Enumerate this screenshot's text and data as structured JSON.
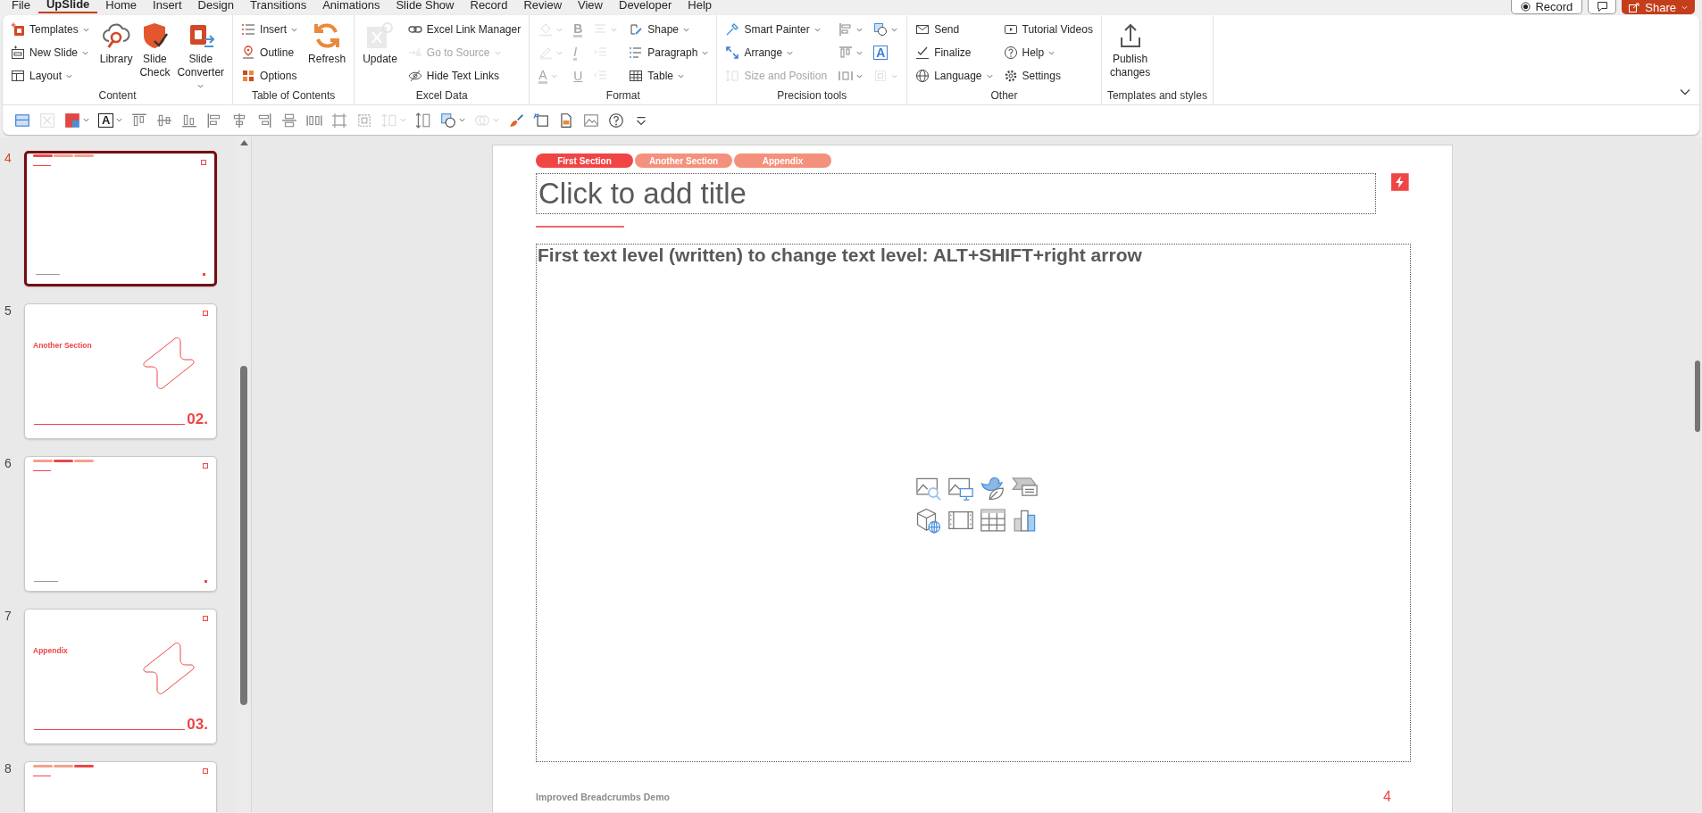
{
  "menu_tabs": [
    {
      "label": "File",
      "selected": false
    },
    {
      "label": "UpSlide",
      "selected": true
    },
    {
      "label": "Home",
      "selected": false
    },
    {
      "label": "Insert",
      "selected": false
    },
    {
      "label": "Design",
      "selected": false
    },
    {
      "label": "Transitions",
      "selected": false
    },
    {
      "label": "Animations",
      "selected": false
    },
    {
      "label": "Slide Show",
      "selected": false
    },
    {
      "label": "Record",
      "selected": false
    },
    {
      "label": "Review",
      "selected": false
    },
    {
      "label": "View",
      "selected": false
    },
    {
      "label": "Developer",
      "selected": false
    },
    {
      "label": "Help",
      "selected": false
    }
  ],
  "title_bar_buttons": {
    "record": "Record",
    "share": "Share"
  },
  "ribbon": [
    {
      "label": "Content",
      "columns": [
        {
          "kind": "small",
          "items": [
            {
              "label": "Templates",
              "caret": true,
              "disabled": false
            },
            {
              "label": "New Slide",
              "caret": true,
              "disabled": false
            },
            {
              "label": "Layout",
              "caret": true,
              "disabled": false
            }
          ]
        },
        {
          "kind": "large",
          "items": [
            {
              "label": "Library",
              "caret": false,
              "disabled": false
            },
            {
              "label": "Slide Check",
              "caret": false,
              "disabled": false
            },
            {
              "label": "Slide Converter",
              "caret": true,
              "disabled": false
            }
          ]
        }
      ]
    },
    {
      "label": "Table of Contents",
      "columns": [
        {
          "kind": "small",
          "items": [
            {
              "label": "Insert",
              "caret": true,
              "disabled": false
            },
            {
              "label": "Outline",
              "caret": false,
              "disabled": false
            },
            {
              "label": "Options",
              "caret": false,
              "disabled": false
            }
          ]
        },
        {
          "kind": "large",
          "items": [
            {
              "label": "Refresh",
              "caret": false,
              "disabled": false
            }
          ]
        }
      ]
    },
    {
      "label": "Excel Data",
      "columns": [
        {
          "kind": "large",
          "items": [
            {
              "label": "Update",
              "caret": false,
              "disabled": true
            }
          ]
        },
        {
          "kind": "small",
          "items": [
            {
              "label": "Excel Link Manager",
              "caret": false,
              "disabled": false
            },
            {
              "label": "Go to Source",
              "caret": true,
              "disabled": true
            },
            {
              "label": "Hide Text Links",
              "caret": false,
              "disabled": false
            }
          ]
        }
      ]
    },
    {
      "label": "Format",
      "columns": [
        {
          "kind": "grid",
          "items": [
            {
              "caret": true,
              "disabled": true
            },
            {
              "label": "B",
              "caret": false,
              "disabled": true
            },
            {
              "caret": true,
              "disabled": true
            },
            {
              "caret": true,
              "disabled": true
            },
            {
              "label": "I",
              "caret": false,
              "disabled": true
            },
            {
              "caret": false,
              "disabled": true
            },
            {
              "label": "A",
              "caret": true,
              "disabled": true
            },
            {
              "label": "U",
              "caret": false,
              "disabled": true
            },
            {
              "caret": false,
              "disabled": true
            }
          ]
        },
        {
          "kind": "small",
          "items": [
            {
              "label": "Shape",
              "caret": true,
              "disabled": false
            },
            {
              "label": "Paragraph",
              "caret": true,
              "disabled": false
            },
            {
              "label": "Table",
              "caret": true,
              "disabled": false
            }
          ]
        }
      ]
    },
    {
      "label": "Precision tools",
      "columns": [
        {
          "kind": "small",
          "items": [
            {
              "label": "Smart Painter",
              "caret": true,
              "disabled": false
            },
            {
              "label": "Arrange",
              "caret": true,
              "disabled": false
            },
            {
              "label": "Size and Position",
              "caret": false,
              "disabled": true
            }
          ]
        },
        {
          "kind": "grid",
          "items": [
            {
              "caret": true,
              "disabled": false
            },
            {
              "caret": true,
              "disabled": false
            },
            {
              "caret": true,
              "disabled": false
            },
            {
              "label": "A",
              "caret": false,
              "disabled": false
            },
            {
              "caret": true,
              "disabled": false
            },
            {
              "caret": true,
              "disabled": true
            }
          ]
        }
      ]
    },
    {
      "label": "Other",
      "columns": [
        {
          "kind": "small",
          "items": [
            {
              "label": "Send",
              "caret": false,
              "disabled": false
            },
            {
              "label": "Finalize",
              "caret": false,
              "disabled": false
            },
            {
              "label": "Language",
              "caret": true,
              "disabled": false
            }
          ]
        },
        {
          "kind": "small",
          "items": [
            {
              "label": "Tutorial Videos",
              "caret": false,
              "disabled": false
            },
            {
              "label": "Help",
              "caret": true,
              "disabled": false
            },
            {
              "label": "Settings",
              "caret": false,
              "disabled": false
            }
          ]
        }
      ]
    },
    {
      "label": "Templates and styles",
      "columns": [
        {
          "kind": "large",
          "items": [
            {
              "label": "Publish changes",
              "caret": false,
              "disabled": false
            }
          ]
        }
      ]
    }
  ],
  "toolbar": [
    {
      "kind": "icon",
      "caret": false,
      "disabled": false
    },
    {
      "kind": "icon",
      "caret": false,
      "disabled": true
    },
    {
      "kind": "icon",
      "caret": true,
      "disabled": false
    },
    {
      "kind": "text",
      "label": "A",
      "caret": true,
      "disabled": false
    },
    {
      "kind": "icon",
      "caret": false,
      "disabled": false
    },
    {
      "kind": "icon",
      "caret": false,
      "disabled": false
    },
    {
      "kind": "icon",
      "caret": false,
      "disabled": false
    },
    {
      "kind": "icon",
      "caret": false,
      "disabled": false
    },
    {
      "kind": "icon",
      "caret": false,
      "disabled": false
    },
    {
      "kind": "icon",
      "caret": false,
      "disabled": false
    },
    {
      "kind": "icon",
      "caret": false,
      "disabled": false
    },
    {
      "kind": "icon",
      "caret": false,
      "disabled": false
    },
    {
      "kind": "icon",
      "caret": false,
      "disabled": false
    },
    {
      "kind": "icon",
      "caret": false,
      "disabled": false
    },
    {
      "kind": "icon",
      "caret": true,
      "disabled": true
    },
    {
      "kind": "icon",
      "caret": false,
      "disabled": false
    },
    {
      "kind": "icon",
      "caret": true,
      "disabled": false
    },
    {
      "kind": "icon",
      "caret": true,
      "disabled": true
    },
    {
      "kind": "icon",
      "caret": false,
      "disabled": false
    },
    {
      "kind": "icon",
      "caret": false,
      "disabled": false
    },
    {
      "kind": "icon",
      "caret": false,
      "disabled": false
    },
    {
      "kind": "icon",
      "caret": false,
      "disabled": false
    },
    {
      "kind": "icon",
      "caret": false,
      "disabled": false
    },
    {
      "kind": "icon",
      "caret": false,
      "disabled": false
    }
  ],
  "thumbnails": [
    {
      "number": "4",
      "kind": "content",
      "selected": true,
      "crumbs": [
        {
          "selected": true
        },
        {
          "selected": false
        },
        {
          "selected": false
        }
      ]
    },
    {
      "number": "5",
      "kind": "section",
      "selected": false,
      "title": "Another Section",
      "section_number": "02."
    },
    {
      "number": "6",
      "kind": "content",
      "selected": false,
      "crumbs": [
        {
          "selected": false
        },
        {
          "selected": true
        },
        {
          "selected": false
        }
      ]
    },
    {
      "number": "7",
      "kind": "section",
      "selected": false,
      "title": "Appendix",
      "section_number": "03."
    },
    {
      "number": "8",
      "kind": "content",
      "selected": false,
      "crumbs": [
        {
          "selected": false
        },
        {
          "selected": false
        },
        {
          "selected": true
        }
      ]
    }
  ],
  "slide": {
    "breadcrumbs": [
      {
        "label": "First Section",
        "selected": true
      },
      {
        "label": "Another Section",
        "selected": false
      },
      {
        "label": "Appendix",
        "selected": false
      }
    ],
    "title_placeholder": "Click to add title",
    "body_text": "First text level (written) to change text level: ALT+SHIFT+right arrow",
    "footer": "Improved Breadcrumbs Demo",
    "page_number": "4"
  }
}
